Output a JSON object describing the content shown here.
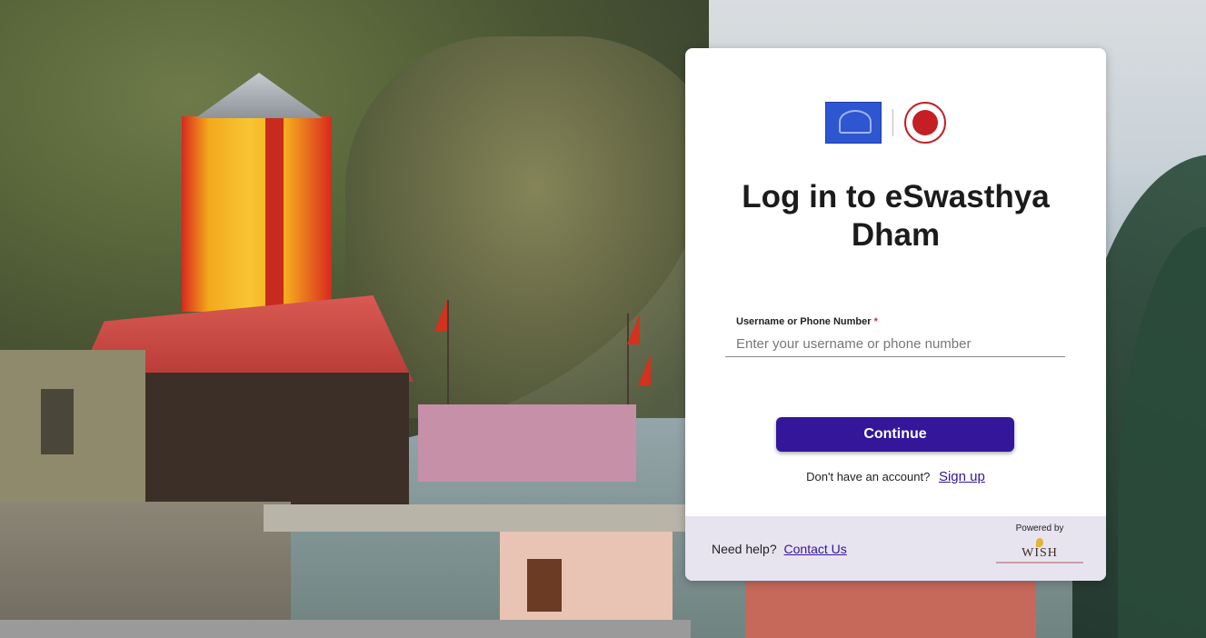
{
  "card": {
    "title": "Log in to eSwasthya Dham",
    "field": {
      "label": "Username or Phone Number",
      "required_mark": "*",
      "placeholder": "Enter your username or phone number",
      "value": ""
    },
    "continue_label": "Continue",
    "signup_prompt": "Don't have an account?",
    "signup_link": "Sign up"
  },
  "footer": {
    "help_prompt": "Need help?",
    "contact_link": "Contact Us",
    "powered_by": "Powered by",
    "wish_logo_text": "WISH"
  },
  "colors": {
    "primary": "#33169a",
    "footer_bg": "#e7e4f0",
    "required": "#d32f2f"
  },
  "icons": {
    "left_logo": "uttarakhand-emblem",
    "right_logo": "national-health-mission-logo"
  }
}
